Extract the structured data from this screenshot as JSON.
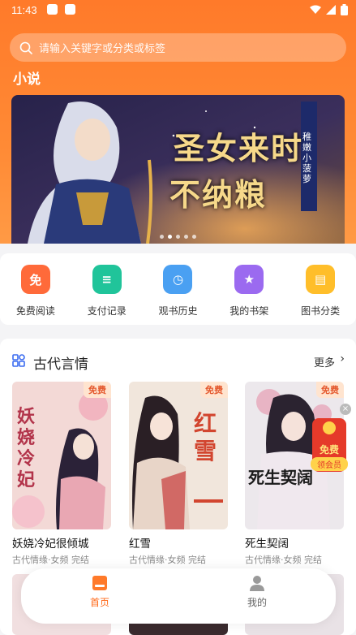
{
  "status": {
    "time": "11:43"
  },
  "search": {
    "placeholder": "请输入关键字或分类或标签"
  },
  "page_title": "小说",
  "banner": {
    "title_line1": "圣女来时",
    "title_line2": "不纳粮",
    "side_text": "稚嫩小菠萝",
    "slide_count": 5,
    "active_slide": 1
  },
  "quick_actions": [
    {
      "label": "免费阅读",
      "icon": "free-read-icon",
      "glyph": "免",
      "color": "#ff6a3a"
    },
    {
      "label": "支付记录",
      "icon": "payment-record-icon",
      "glyph": "≡",
      "color": "#20c49a"
    },
    {
      "label": "观书历史",
      "icon": "history-clock-icon",
      "glyph": "◷",
      "color": "#4aa0f2"
    },
    {
      "label": "我的书架",
      "icon": "bookshelf-icon",
      "glyph": "★",
      "color": "#9b6af0"
    },
    {
      "label": "图书分类",
      "icon": "category-book-icon",
      "glyph": "▤",
      "color": "#ffbe2a"
    }
  ],
  "section": {
    "title": "古代言情",
    "more": "更多",
    "books": [
      {
        "title": "妖娆冷妃很倾城",
        "meta": "古代情缘·女频 完结",
        "badge": "免费",
        "cover_text": "妖娆冷妃"
      },
      {
        "title": "红雪",
        "meta": "古代情缘·女频 完结",
        "badge": "免费",
        "cover_text": "红雪"
      },
      {
        "title": "死生契阔",
        "meta": "古代情缘·女频 完结",
        "badge": "免费",
        "cover_text": "死生契阔"
      }
    ]
  },
  "promo": {
    "line1": "免费",
    "line2": "领会员"
  },
  "tabbar": {
    "home": "首页",
    "mine": "我的"
  }
}
